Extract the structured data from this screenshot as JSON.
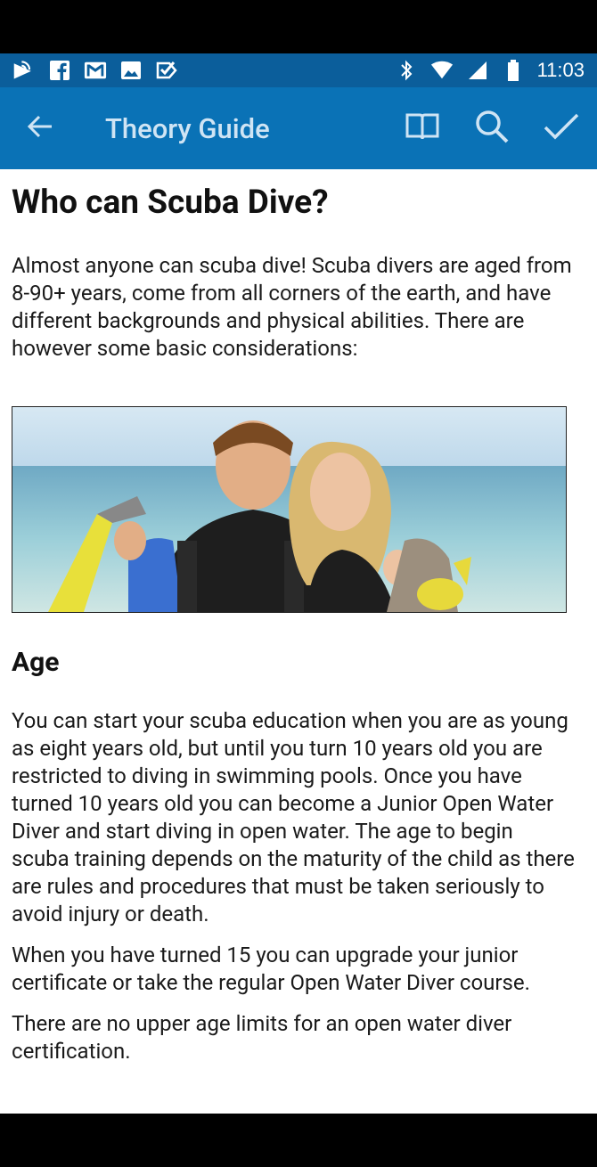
{
  "status_bar": {
    "time": "11:03",
    "left_icons": [
      "cast-icon",
      "facebook-icon",
      "gmail-icon",
      "image-icon",
      "check-box-icon"
    ],
    "right_icons": [
      "bluetooth-icon",
      "wifi-icon",
      "cell-signal-icon",
      "battery-icon"
    ]
  },
  "app_bar": {
    "title": "Theory Guide",
    "actions": [
      "book-icon",
      "search-icon",
      "check-icon"
    ]
  },
  "article": {
    "title": "Who can Scuba Dive?",
    "intro": "Almost anyone can scuba dive! Scuba divers are aged from 8-90+ years, come from all corners of the earth, and have different backgrounds and physical abilities. There are however some basic considerations:",
    "age_heading": "Age",
    "age_p1": "You can start your scuba education when you are as young as eight years old, but until you turn 10 years old you are restricted to diving in swimming pools. Once you have turned 10 years old you can become a Junior Open Water Diver and start diving in open water. The age to begin scuba training depends on the maturity of the child as there are rules and procedures that must be taken seriously to avoid injury or death.",
    "age_p2": "When you have turned 15 you can upgrade your junior certificate or take the regular Open Water Diver course.",
    "age_p3": "There are no upper age limits for an open water diver certification."
  },
  "colors": {
    "status_bar": "#0b5e9b",
    "app_bar": "#0a72b6",
    "app_bar_text": "#cfe4f4"
  }
}
